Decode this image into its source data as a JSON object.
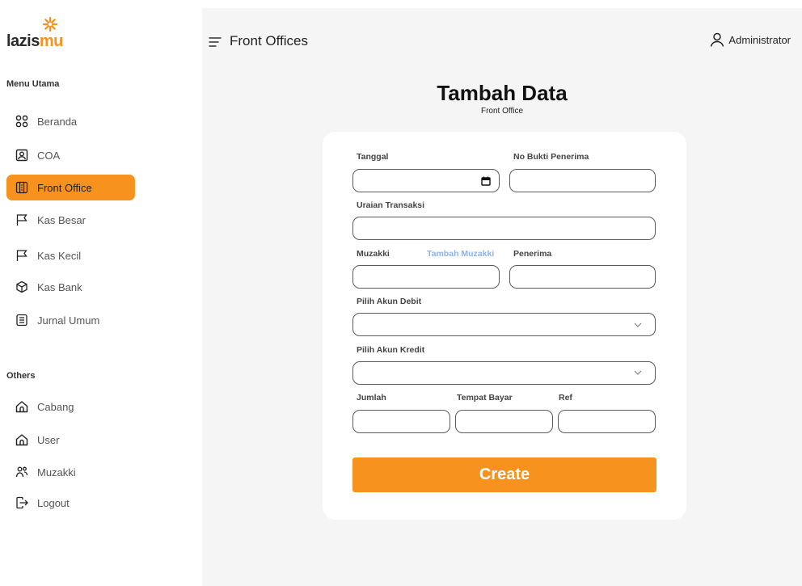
{
  "brand": {
    "name_part1": "lazis",
    "name_part2": "mu",
    "accent": "#f7921e"
  },
  "sidebar": {
    "menu_utama_title": "Menu Utama",
    "menu_items": [
      {
        "label": "Beranda",
        "icon": "grid-icon"
      },
      {
        "label": "COA",
        "icon": "user-square-icon"
      },
      {
        "label": "Front Office",
        "icon": "building-icon",
        "active": true
      },
      {
        "label": "Kas Besar",
        "icon": "flag-icon"
      },
      {
        "label": "Kas Kecil",
        "icon": "flag-icon"
      },
      {
        "label": "Kas Bank",
        "icon": "cube-icon"
      },
      {
        "label": "Jurnal Umum",
        "icon": "document-icon"
      }
    ],
    "others_title": "Others",
    "other_items": [
      {
        "label": "Cabang",
        "icon": "home-icon"
      },
      {
        "label": "User",
        "icon": "home-icon"
      },
      {
        "label": "Muzakki",
        "icon": "users-icon"
      },
      {
        "label": "Logout",
        "icon": "logout-icon"
      }
    ]
  },
  "header": {
    "title": "Front Offices",
    "user": "Administrator"
  },
  "form": {
    "title": "Tambah Data",
    "subtitle": "Front Office",
    "labels": {
      "tanggal": "Tanggal",
      "no_bukti": "No Bukti Penerima",
      "uraian": "Uraian Transaksi",
      "muzakki": "Muzakki",
      "tambah_muzakki": "Tambah Muzakki",
      "penerima": "Penerima",
      "akun_debit": "Pilih Akun Debit",
      "akun_kredit": "Pilih Akun Kredit",
      "jumlah": "Jumlah",
      "tempat_bayar": "Tempat Bayar",
      "ref": "Ref"
    },
    "values": {
      "tanggal": "",
      "no_bukti": "",
      "uraian": "",
      "muzakki": "",
      "penerima": "",
      "akun_debit": "",
      "akun_kredit": "",
      "jumlah": "",
      "tempat_bayar": "",
      "ref": ""
    },
    "create_label": "Create"
  }
}
